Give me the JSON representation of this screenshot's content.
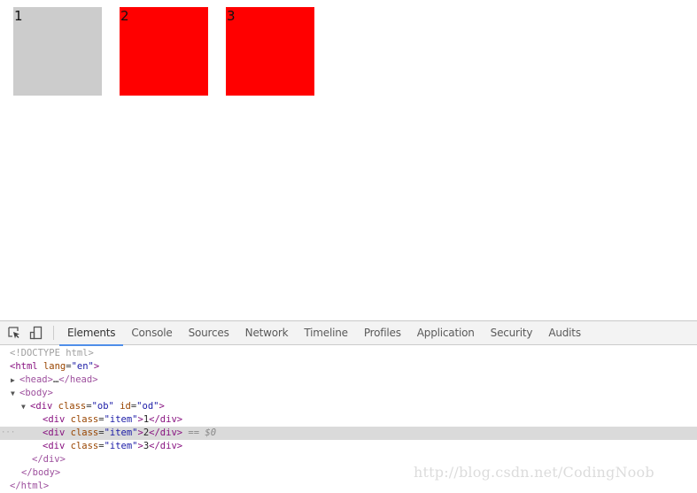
{
  "page": {
    "items": [
      {
        "label": "1",
        "color": "#cccccc"
      },
      {
        "label": "2",
        "color": "#ff0000"
      },
      {
        "label": "3",
        "color": "#ff0000"
      }
    ]
  },
  "devtools": {
    "toolbar": {
      "inspect_icon": "element-picker-icon",
      "device_icon": "device-toolbar-icon"
    },
    "tabs": [
      {
        "label": "Elements",
        "active": true
      },
      {
        "label": "Console"
      },
      {
        "label": "Sources"
      },
      {
        "label": "Network"
      },
      {
        "label": "Timeline"
      },
      {
        "label": "Profiles"
      },
      {
        "label": "Application"
      },
      {
        "label": "Security"
      },
      {
        "label": "Audits"
      }
    ],
    "dom": {
      "doctype": "<!DOCTYPE html>",
      "html_open": "<html",
      "html_attr": "lang",
      "html_attr_val": "\"en\"",
      "head_open": "<head>",
      "head_ellipsis": "…",
      "head_close": "</head>",
      "body_open": "<body>",
      "div_tag": "<div",
      "div_class_attr": "class",
      "div_class_val": "\"ob\"",
      "div_id_attr": "id",
      "div_id_val": "\"od\"",
      "children": [
        {
          "tag_open": "<div",
          "attr": "class",
          "val": "\"item\"",
          "text": "1",
          "tag_close": "</div>"
        },
        {
          "tag_open": "<div",
          "attr": "class",
          "val": "\"item\"",
          "text": "2",
          "tag_close": "</div>",
          "selected_marker": "== $0"
        },
        {
          "tag_open": "<div",
          "attr": "class",
          "val": "\"item\"",
          "text": "3",
          "tag_close": "</div>"
        }
      ],
      "div_close": "</div>",
      "body_close": "</body>",
      "html_close": "</html>",
      "gt": ">",
      "eq": "=",
      "dots": "···"
    }
  },
  "watermark": "http://blog.csdn.net/CodingNoob"
}
